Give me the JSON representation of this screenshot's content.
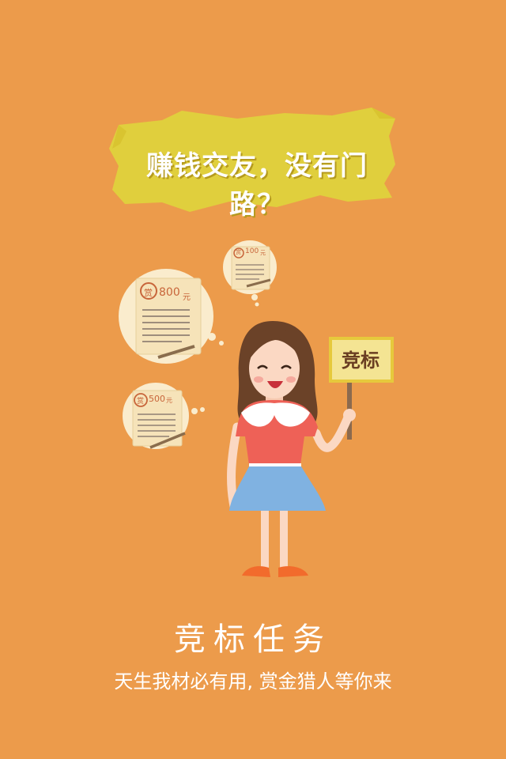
{
  "banner": {
    "text": "赚钱交友，没有门路？"
  },
  "bubbles": {
    "large": {
      "badge": "赏",
      "amount": "800",
      "unit": "元"
    },
    "small": {
      "badge": "赏",
      "amount": "100",
      "unit": "元"
    },
    "medium": {
      "badge": "赏",
      "amount": "500",
      "unit": "元"
    }
  },
  "sign": {
    "text": "竞标"
  },
  "title": "竞标任务",
  "subtitle": "天生我材必有用, 赏金猎人等你来",
  "colors": {
    "background": "#ec9b4b",
    "banner": "#e0cf3d",
    "accent": "#c8653a"
  }
}
